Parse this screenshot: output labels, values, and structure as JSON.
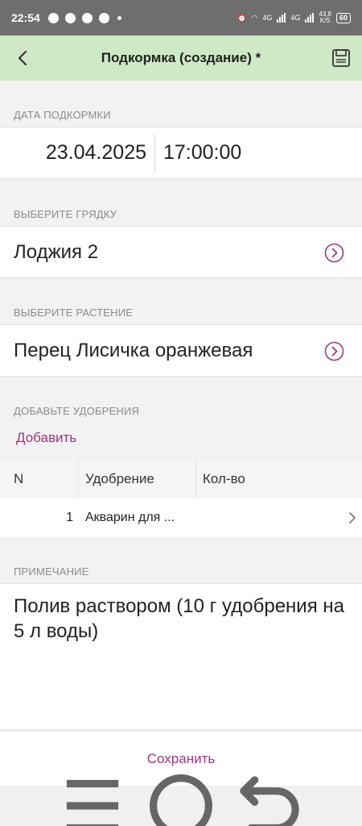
{
  "status_bar": {
    "time": "22:54",
    "network_left": "4G",
    "network_right": "4G",
    "speed": "43,8\nK/S",
    "battery": "60"
  },
  "app_bar": {
    "title": "Подкормка (создание) *"
  },
  "date_section": {
    "label": "ДАТА ПОДКОРМКИ",
    "date": "23.04.2025",
    "time": "17:00:00"
  },
  "bed_section": {
    "label": "ВЫБЕРИТЕ ГРЯДКУ",
    "value": "Лоджия 2"
  },
  "plant_section": {
    "label": "ВЫБЕРИТЕ РАСТЕНИЕ",
    "value": "Перец Лисичка оранжевая"
  },
  "fertilizer_section": {
    "label": "ДОБАВЬТЕ УДОБРЕНИЯ",
    "add_link": "Добавить",
    "columns": [
      "N",
      "Удобрение",
      "Кол-во"
    ],
    "rows": [
      {
        "n": "1",
        "name": "Акварин для ...",
        "qty": ""
      }
    ]
  },
  "note_section": {
    "label": "ПРИМЕЧАНИЕ",
    "text": "Полив раствором (10 г удобрения на 5 л воды)"
  },
  "save_button": "Сохранить",
  "colors": {
    "app_bar": "#cfe9c6",
    "accent": "#a0367f",
    "status_bar": "#6e6e6e"
  }
}
